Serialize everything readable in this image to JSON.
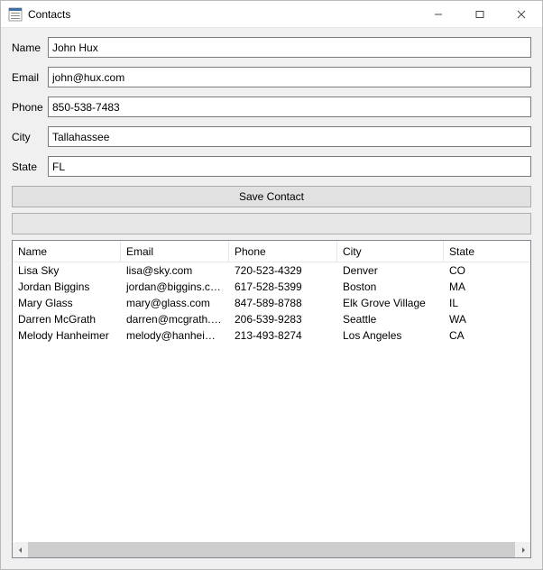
{
  "window": {
    "title": "Contacts"
  },
  "form": {
    "labels": {
      "name": "Name",
      "email": "Email",
      "phone": "Phone",
      "city": "City",
      "state": "State"
    },
    "values": {
      "name": "John Hux",
      "email": "john@hux.com",
      "phone": "850-538-7483",
      "city": "Tallahassee",
      "state": "FL"
    }
  },
  "buttons": {
    "save": "Save Contact",
    "secondary": ""
  },
  "table": {
    "headers": {
      "name": "Name",
      "email": "Email",
      "phone": "Phone",
      "city": "City",
      "state": "State"
    },
    "rows": [
      {
        "name": "Lisa Sky",
        "email": "lisa@sky.com",
        "phone": "720-523-4329",
        "city": "Denver",
        "state": "CO"
      },
      {
        "name": "Jordan Biggins",
        "email": "jordan@biggins.com",
        "phone": "617-528-5399",
        "city": "Boston",
        "state": "MA"
      },
      {
        "name": "Mary Glass",
        "email": "mary@glass.com",
        "phone": "847-589-8788",
        "city": "Elk Grove Village",
        "state": "IL"
      },
      {
        "name": "Darren McGrath",
        "email": "darren@mcgrath.c…",
        "phone": "206-539-9283",
        "city": "Seattle",
        "state": "WA"
      },
      {
        "name": "Melody Hanheimer",
        "email": "melody@hanheime…",
        "phone": "213-493-8274",
        "city": "Los Angeles",
        "state": "CA"
      }
    ]
  }
}
